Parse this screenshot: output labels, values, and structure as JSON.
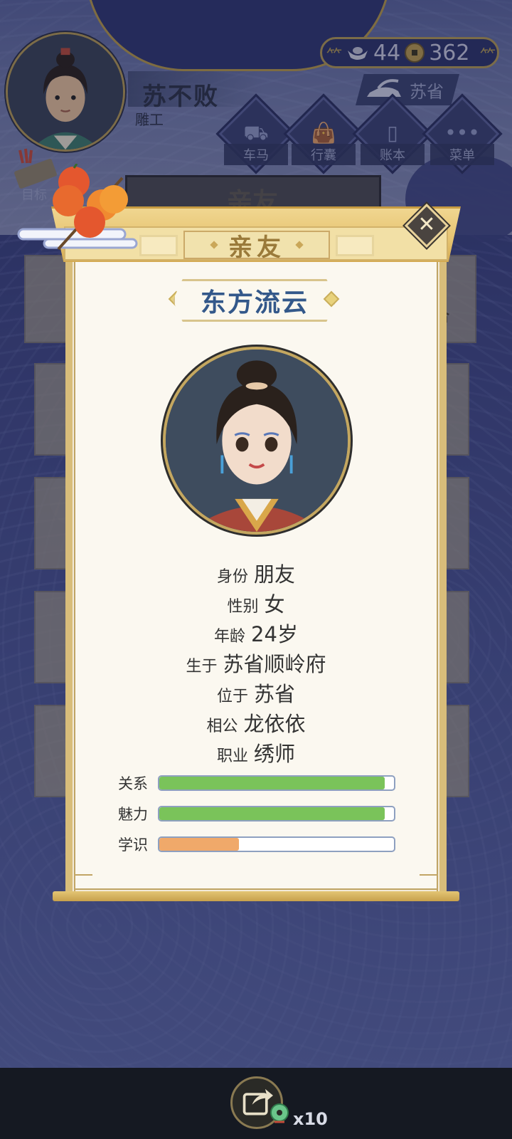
{
  "player": {
    "name": "苏不败",
    "title": "雕工"
  },
  "currency": {
    "silver": "44",
    "coins": "362"
  },
  "location": {
    "label": "苏省"
  },
  "menu": [
    {
      "label": "车马",
      "icon": "carriage-icon"
    },
    {
      "label": "行囊",
      "icon": "bag-icon"
    },
    {
      "label": "账本",
      "icon": "ledger-icon"
    },
    {
      "label": "菜单",
      "icon": "more-icon"
    }
  ],
  "goal": {
    "label": "目标"
  },
  "background_panel": {
    "title": "亲友",
    "side_text": "合"
  },
  "dialog": {
    "tab_title": "亲友",
    "character_name": "东方流云",
    "info": [
      {
        "label": "身份",
        "value": "朋友"
      },
      {
        "label": "性别",
        "value": "女"
      },
      {
        "label": "年龄",
        "value": "24岁"
      },
      {
        "label": "生于",
        "value": "苏省顺岭府"
      },
      {
        "label": "位于",
        "value": "苏省"
      },
      {
        "label": "相公",
        "value": "龙依依"
      },
      {
        "label": "职业",
        "value": "绣师"
      }
    ],
    "stats": [
      {
        "label": "关系",
        "value": 0.96,
        "color": "#7ac35a"
      },
      {
        "label": "魅力",
        "value": 0.96,
        "color": "#7ac35a"
      },
      {
        "label": "学识",
        "value": 0.34,
        "color": "#f0a96a"
      }
    ]
  },
  "bottom": {
    "share_count": "x10"
  }
}
